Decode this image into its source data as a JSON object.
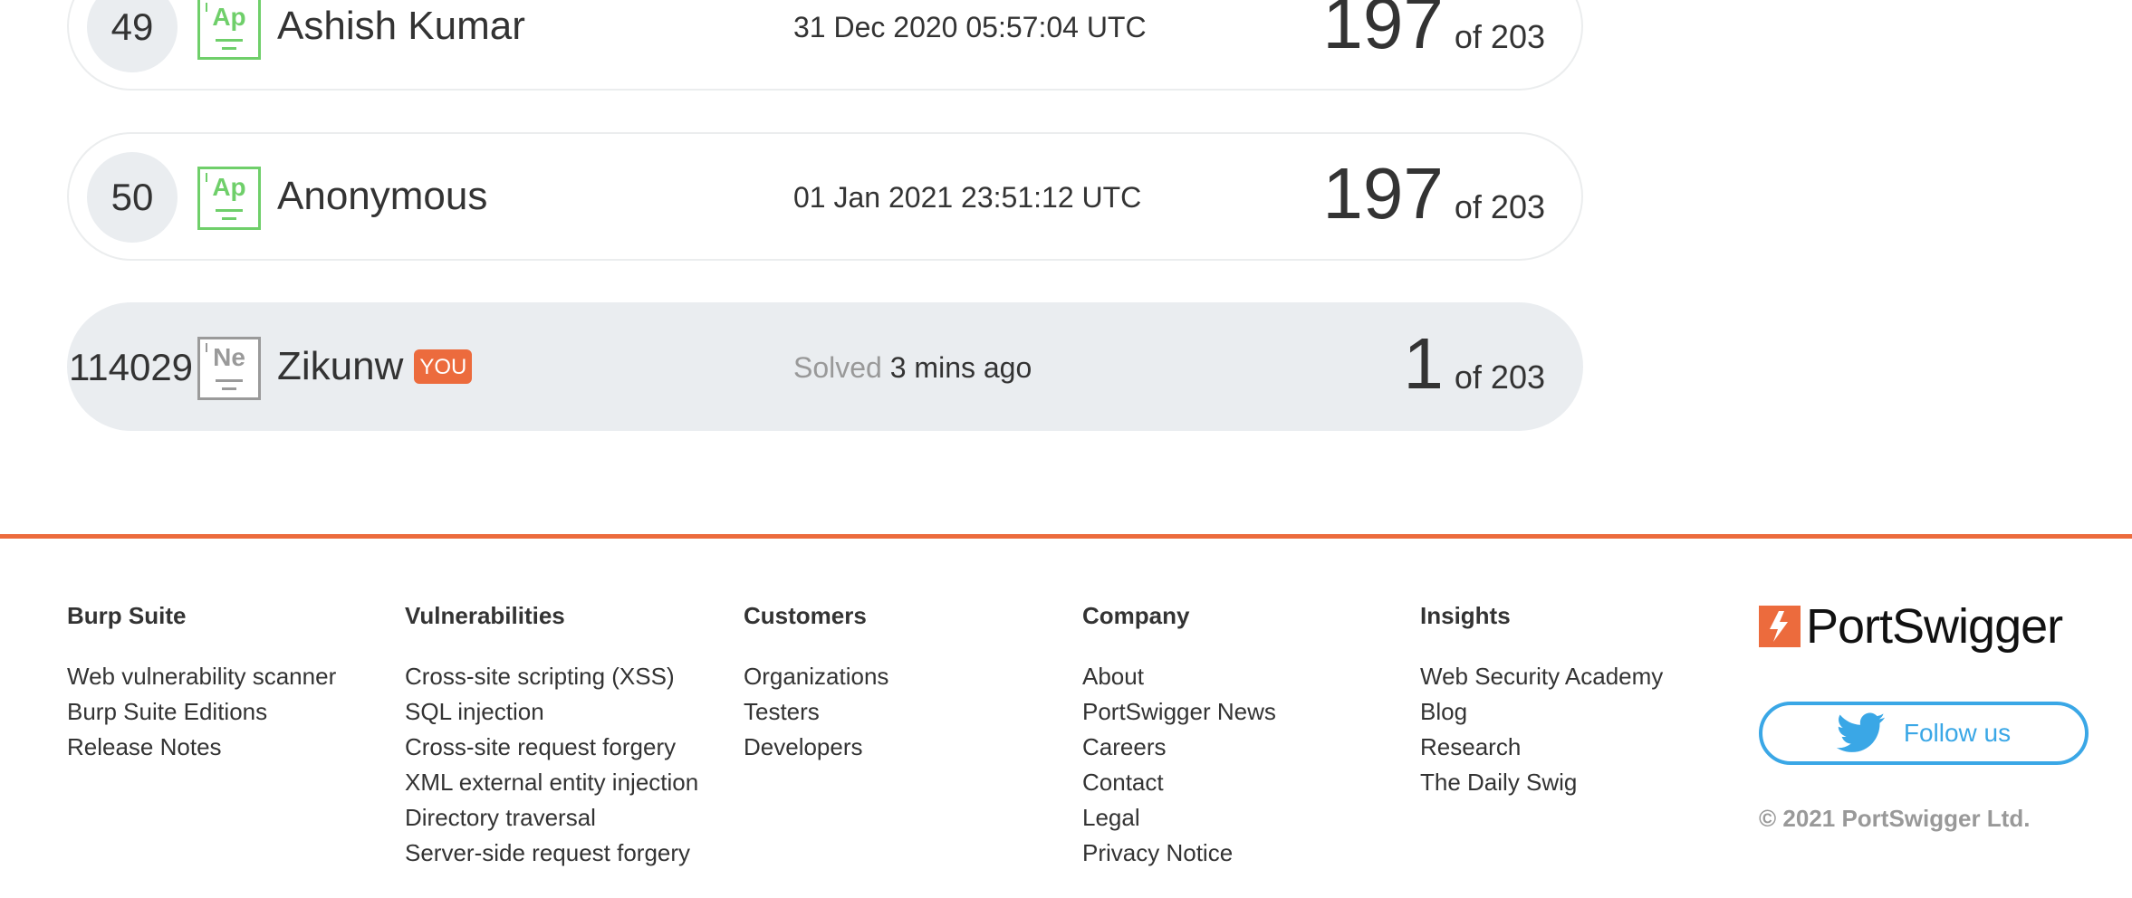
{
  "leaderboard": {
    "rows": [
      {
        "rank": "49",
        "badge_symbol": "Ap",
        "name": "Ashish Kumar",
        "date": "31 Dec 2020 05:57:04 UTC",
        "score": "197",
        "of_total": "of 203"
      },
      {
        "rank": "50",
        "badge_symbol": "Ap",
        "name": "Anonymous",
        "date": "01 Jan 2021 23:51:12 UTC",
        "score": "197",
        "of_total": "of 203"
      }
    ],
    "you": {
      "rank": "114029",
      "badge_symbol": "Ne",
      "name": "Zikunw",
      "tag": "YOU",
      "solved_prefix": "Solved",
      "solved_time": "3 mins ago",
      "score": "1",
      "of_total": "of 203"
    }
  },
  "colors": {
    "accent": "#ec6b3d",
    "badge_green": "#6fcf6a",
    "twitter_blue": "#3aa7e6"
  },
  "footer": {
    "columns": [
      {
        "heading": "Burp Suite",
        "links": [
          "Web vulnerability scanner",
          "Burp Suite Editions",
          "Release Notes"
        ]
      },
      {
        "heading": "Vulnerabilities",
        "links": [
          "Cross-site scripting (XSS)",
          "SQL injection",
          "Cross-site request forgery",
          "XML external entity injection",
          "Directory traversal",
          "Server-side request forgery"
        ]
      },
      {
        "heading": "Customers",
        "links": [
          "Organizations",
          "Testers",
          "Developers"
        ]
      },
      {
        "heading": "Company",
        "links": [
          "About",
          "PortSwigger News",
          "Careers",
          "Contact",
          "Legal",
          "Privacy Notice"
        ]
      },
      {
        "heading": "Insights",
        "links": [
          "Web Security Academy",
          "Blog",
          "Research",
          "The Daily Swig"
        ]
      }
    ],
    "brand": {
      "logo_text": "PortSwigger",
      "follow_label": "Follow us",
      "follow_icon": "twitter-bird-icon",
      "copyright": "© 2021 PortSwigger Ltd."
    }
  }
}
